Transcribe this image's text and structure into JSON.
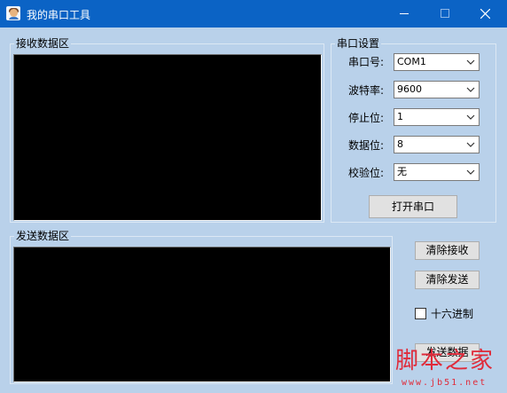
{
  "window": {
    "title": "我的串口工具"
  },
  "receive": {
    "caption": "接收数据区"
  },
  "send": {
    "caption": "发送数据区"
  },
  "serial_settings": {
    "caption": "串口设置",
    "fields": [
      {
        "label": "串口号:",
        "value": "COM1"
      },
      {
        "label": "波特率:",
        "value": "9600"
      },
      {
        "label": "停止位:",
        "value": "1"
      },
      {
        "label": "数据位:",
        "value": "8"
      },
      {
        "label": "校验位:",
        "value": "无"
      }
    ],
    "open_button": "打开串口"
  },
  "actions": {
    "clear_receive": "清除接收",
    "clear_send": "清除发送",
    "hex_label": "十六进制",
    "hex_checked": false,
    "send_button": "发送数据"
  },
  "watermark": {
    "brand": "脚本之家",
    "url": "www.jb51.net"
  },
  "colors": {
    "titlebar": "#0b63c5",
    "client": "#b9d1ea",
    "watermark": "#e02b3a"
  }
}
